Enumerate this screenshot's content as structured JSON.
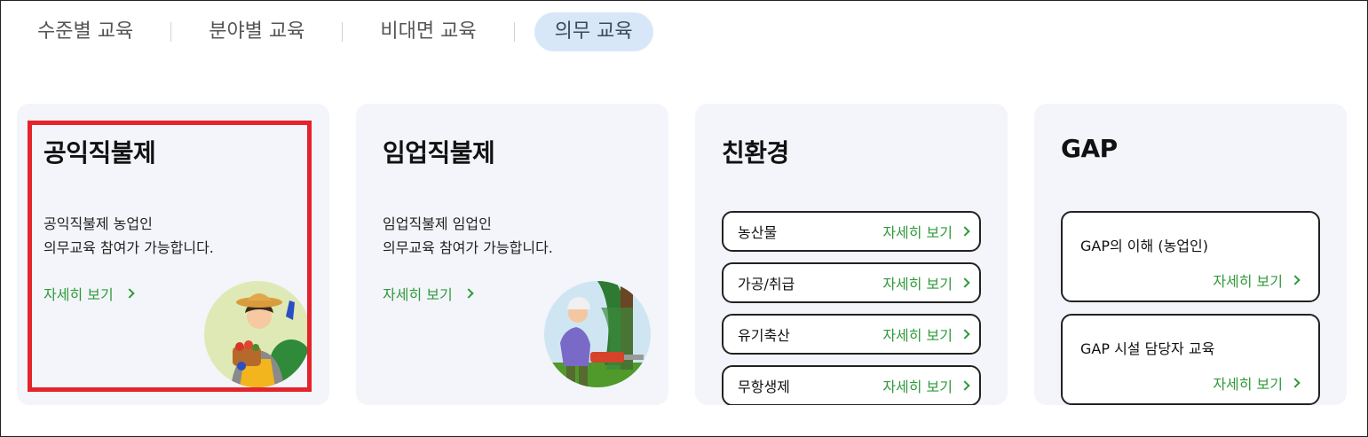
{
  "tabs": [
    {
      "label": "수준별 교육"
    },
    {
      "label": "분야별 교육"
    },
    {
      "label": "비대면 교육"
    },
    {
      "label": "의무 교육",
      "active": true
    }
  ],
  "cards": {
    "public_direct": {
      "title": "공익직불제",
      "desc_line1": "공익직불제 농업인",
      "desc_line2": "의무교육 참여가 가능합니다.",
      "more": "자세히 보기"
    },
    "forestry_direct": {
      "title": "임업직불제",
      "desc_line1": "임업직불제 임업인",
      "desc_line2": "의무교육 참여가 가능합니다.",
      "more": "자세히 보기"
    },
    "eco": {
      "title": "친환경",
      "items": [
        {
          "label": "농산물",
          "more": "자세히 보기"
        },
        {
          "label": "가공/취급",
          "more": "자세히 보기"
        },
        {
          "label": "유기축산",
          "more": "자세히 보기"
        },
        {
          "label": "무항생제",
          "more": "자세히 보기"
        }
      ]
    },
    "gap": {
      "title": "GAP",
      "items": [
        {
          "label": "GAP의 이해 (농업인)",
          "more": "자세히 보기"
        },
        {
          "label": "GAP 시설 담당자 교육",
          "more": "자세히 보기"
        }
      ]
    }
  },
  "colors": {
    "accent_green": "#2f9a3a",
    "active_tab_bg": "#d7e7f8",
    "card_bg": "#f3f5fa",
    "highlight_red": "#e4232b"
  },
  "icons": [
    "chevron-right-icon",
    "farmer-illustration",
    "forester-illustration"
  ]
}
